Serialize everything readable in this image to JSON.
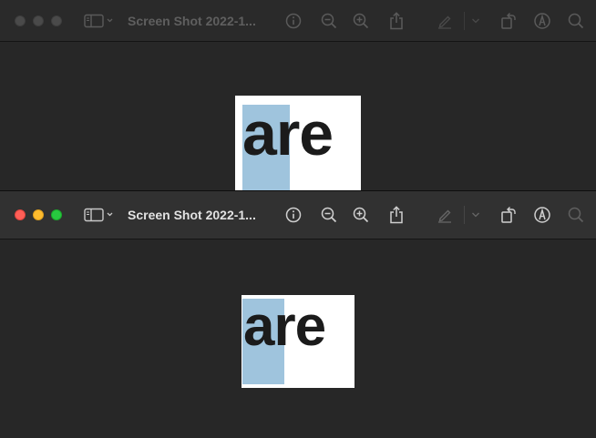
{
  "windows": [
    {
      "state": "inactive",
      "title": "Screen Shot 2022-1...",
      "preview_text": "are"
    },
    {
      "state": "active",
      "title": "Screen Shot 2022-1...",
      "preview_text": "are",
      "traffic_colors": {
        "close": "#fe5f57",
        "minimize": "#febc2e",
        "zoom": "#28c840"
      }
    }
  ],
  "toolbar_icons": [
    "info-icon",
    "zoom-out-icon",
    "zoom-in-icon",
    "share-icon",
    "markup-pen-icon",
    "chevron-down-icon",
    "rotate-icon",
    "annotate-icon",
    "search-icon"
  ],
  "colors": {
    "selection_highlight": "#9fc4dd",
    "background": "#272727"
  }
}
